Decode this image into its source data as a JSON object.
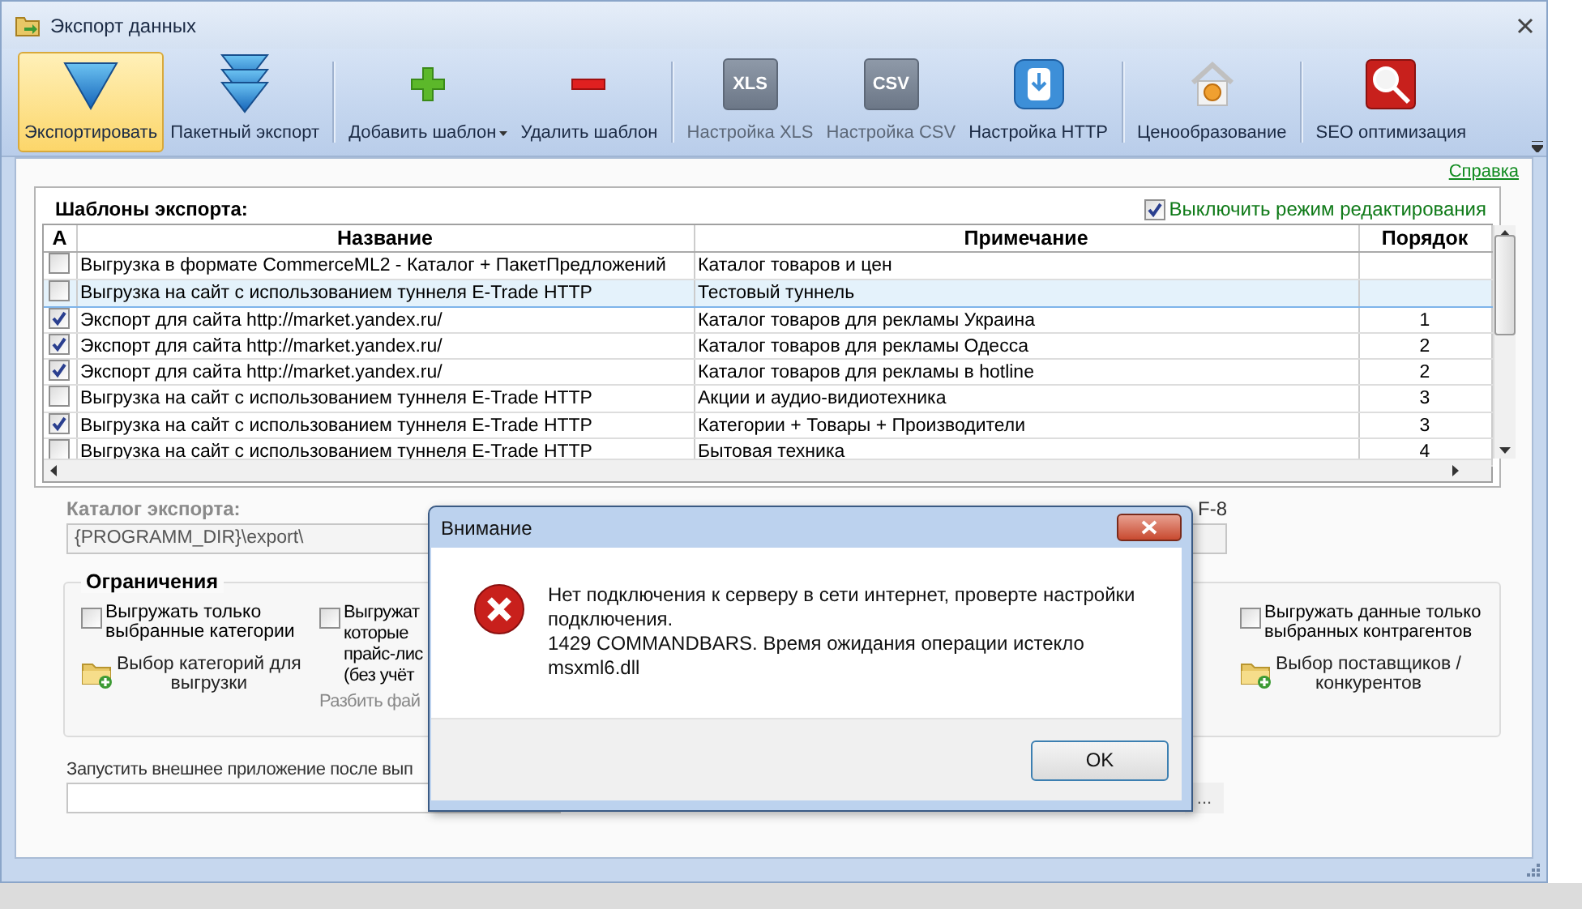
{
  "window": {
    "title": "Экспорт данных"
  },
  "toolbar": [
    {
      "buttons": [
        {
          "kind": "export",
          "label": "Экспортировать",
          "selected": true,
          "disabled": false
        },
        {
          "kind": "batch",
          "label": "Пакетный экспорт",
          "selected": false,
          "disabled": false
        }
      ]
    },
    {
      "buttons": [
        {
          "kind": "add",
          "label": "Добавить шаблон",
          "selected": false,
          "disabled": false,
          "dropdown": true
        },
        {
          "kind": "remove",
          "label": "Удалить шаблон",
          "selected": false,
          "disabled": false
        }
      ]
    },
    {
      "buttons": [
        {
          "kind": "badge",
          "label": "Настройка XLS",
          "icon_text": "XLS",
          "selected": false,
          "disabled": true
        },
        {
          "kind": "badge",
          "label": "Настройка CSV",
          "icon_text": "CSV",
          "selected": false,
          "disabled": true
        },
        {
          "kind": "http",
          "label": "Настройка HTTP",
          "selected": false,
          "disabled": false
        }
      ]
    },
    {
      "buttons": [
        {
          "kind": "price",
          "label": "Ценообразование",
          "selected": false,
          "disabled": false
        }
      ]
    },
    {
      "buttons": [
        {
          "kind": "seo",
          "label": "SEO оптимизация",
          "selected": false,
          "disabled": false
        }
      ]
    }
  ],
  "help_link": "Справка",
  "templates": {
    "title": "Шаблоны экспорта:",
    "edit_lock": {
      "label": "Выключить режим редактирования",
      "checked": true
    },
    "columns": [
      "А",
      "Название",
      "Примечание",
      "Порядок"
    ],
    "rows": [
      {
        "active": false,
        "selected": false,
        "name": "Выгрузка в формате CommerceML2 - Каталог + ПакетПредложений",
        "note": "Каталог товаров и цен"
      },
      {
        "active": false,
        "selected": true,
        "name": "Выгрузка на сайт с использованием туннеля E-Trade HTTP",
        "note": "Тестовый туннель"
      },
      {
        "active": true,
        "selected": false,
        "name": "Экспорт для сайта http://market.yandex.ru/",
        "note": "Каталог товаров для рекламы Украина",
        "order": "1"
      },
      {
        "active": true,
        "selected": false,
        "name": "Экспорт для сайта http://market.yandex.ru/",
        "note": "Каталог товаров для рекламы Одесса",
        "order": "2"
      },
      {
        "active": true,
        "selected": false,
        "name": "Экспорт для сайта http://market.yandex.ru/",
        "note": "Каталог товаров для рекламы в hotline",
        "order": "2"
      },
      {
        "active": false,
        "selected": false,
        "name": "Выгрузка на сайт с использованием туннеля E-Trade HTTP",
        "note": "Акции и аудио-видиотехника",
        "order": "3"
      },
      {
        "active": true,
        "selected": false,
        "name": "Выгрузка на сайт с использованием туннеля E-Trade HTTP",
        "note": "Категории + Товары + Производители",
        "order": "3"
      },
      {
        "active": false,
        "selected": false,
        "name": "Выгрузка на сайт с использованием туннеля E-Trade HTTP",
        "note": "Бытовая техника",
        "order": "4"
      }
    ]
  },
  "catalog": {
    "label": "Каталог экспорта:",
    "value": "{PROGRAMM_DIR}\\export\\",
    "encoding_fragment": "F-8"
  },
  "limits": {
    "title": "Ограничения",
    "options": [
      {
        "kind": "checkbox",
        "label": "Выгружать только\nвыбранные категории",
        "checked": false
      },
      {
        "kind": "folder",
        "label": "Выбор категорий для\nвыгрузки"
      },
      {
        "kind": "checkbox",
        "label": "Выгружат\nкоторые\nпрайс-лис\n(без учёт",
        "checked": false
      },
      {
        "kind": "text",
        "label": "Разбить фай"
      },
      {
        "kind": "checkbox",
        "label": "Выгружать данные только\nвыбранных контрагентов",
        "checked": false
      },
      {
        "kind": "folder",
        "label": "Выбор поставщиков /\nконкурентов"
      }
    ]
  },
  "run_after": {
    "label": "Запустить внешнее приложение после вып",
    "browse": "..."
  },
  "dialog": {
    "title": "Внимание",
    "message": "Нет подключения к серверу в сети интернет, проверте настройки\nподключения.\n1429 COMMANDBARS. Время ожидания операции истекло\n msxml6.dll",
    "ok": "OK"
  }
}
